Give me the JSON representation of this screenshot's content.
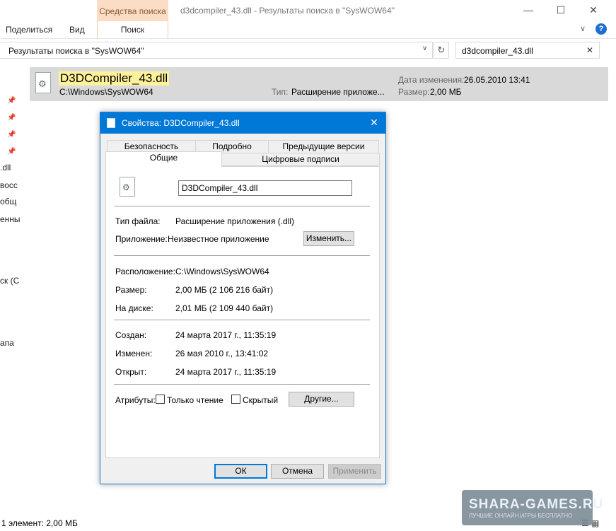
{
  "explorer": {
    "context_tab": "Средства поиска",
    "window_title": "d3dcompiler_43.dll - Результаты поиска в \"SysWOW64\"",
    "caption": {
      "minimize": "—",
      "maximize": "☐",
      "close": "✕"
    },
    "ribbon_tabs": [
      "Поделиться",
      "Вид",
      "Поиск"
    ],
    "ribbon_expand": "∨",
    "help": "?",
    "address": "Результаты поиска в \"SysWOW64\"",
    "address_dropdown": "∨",
    "refresh": "↻",
    "search_value": "d3dcompiler_43.dll",
    "search_clear": "✕",
    "nav_items": [
      ".dll",
      "восс",
      "общ",
      "енны",
      "ск (С",
      "апа"
    ],
    "result": {
      "name": "D3DCompiler_43.dll",
      "path": "C:\\Windows\\SysWOW64",
      "type_label": "Тип:",
      "type_value": "Расширение приложе...",
      "date_label": "Дата изменения:",
      "date_value": "26.05.2010 13:41",
      "size_label": "Размер:",
      "size_value": "2,00 МБ"
    },
    "status": "1 элемент: 2,00 МБ",
    "view_icons": "☰ ▦"
  },
  "watermark": {
    "text": "SHARA-GAMES.RU",
    "sub": "ЛУЧШИЕ ОНЛАЙН   ИГРЫ БЕСПЛАТНО"
  },
  "dialog": {
    "title": "Свойства: D3DCompiler_43.dll",
    "close": "✕",
    "tabs_back": [
      "Безопасность",
      "Подробно",
      "Предыдущие версии"
    ],
    "tabs_front": [
      "Общие",
      "Цифровые подписи"
    ],
    "filename": "D3DCompiler_43.dll",
    "rows": {
      "file_type_label": "Тип файла:",
      "file_type_value": "Расширение приложения (.dll)",
      "app_label": "Приложение:",
      "app_value": "Неизвестное приложение",
      "change_button": "Изменить...",
      "location_label": "Расположение:",
      "location_value": "C:\\Windows\\SysWOW64",
      "size_label": "Размер:",
      "size_value": "2,00 МБ (2 106 216 байт)",
      "ondisk_label": "На диске:",
      "ondisk_value": "2,01 МБ (2 109 440 байт)",
      "created_label": "Создан:",
      "created_value": "24 марта 2017 г., 11:35:19",
      "modified_label": "Изменен:",
      "modified_value": "26 мая 2010 г., 13:41:02",
      "opened_label": "Открыт:",
      "opened_value": "24 марта 2017 г., 11:35:19",
      "attributes_label": "Атрибуты:",
      "readonly_label": "Только чтение",
      "hidden_label": "Скрытый",
      "other_button": "Другие..."
    },
    "buttons": {
      "ok": "ОК",
      "cancel": "Отмена",
      "apply": "Применить"
    }
  }
}
